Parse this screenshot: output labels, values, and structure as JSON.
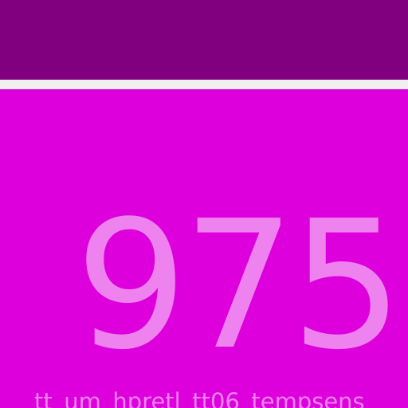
{
  "header": {
    "background": "#800080"
  },
  "tile": {
    "value": "975",
    "caption": "tt_um_hpretl_tt06_tempsens",
    "background": "#dd00dd",
    "text_color": "#ee82ee"
  }
}
